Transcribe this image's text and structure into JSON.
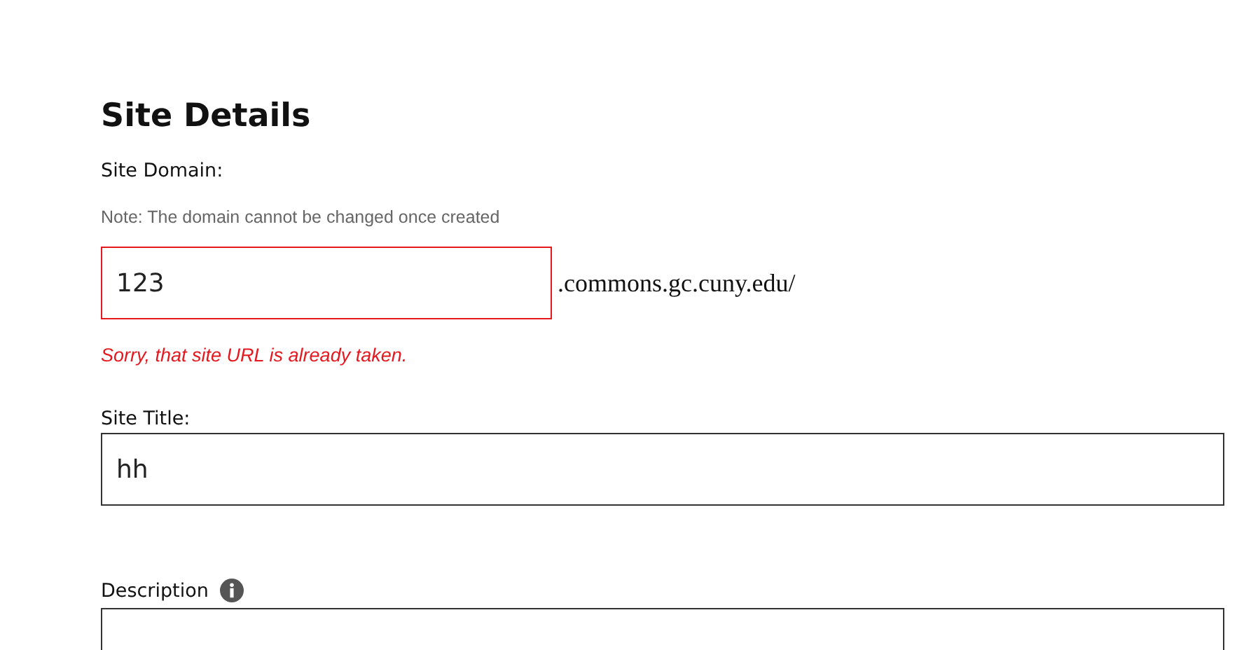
{
  "heading": "Site Details",
  "domain": {
    "label": "Site Domain:",
    "note": "Note: The domain cannot be changed once created",
    "value": "123",
    "invalid": true,
    "suffix": ".commons.gc.cuny.edu/",
    "error": "Sorry, that site URL is already taken."
  },
  "title_field": {
    "label": "Site Title:",
    "value": "hh"
  },
  "description": {
    "label": "Description"
  }
}
